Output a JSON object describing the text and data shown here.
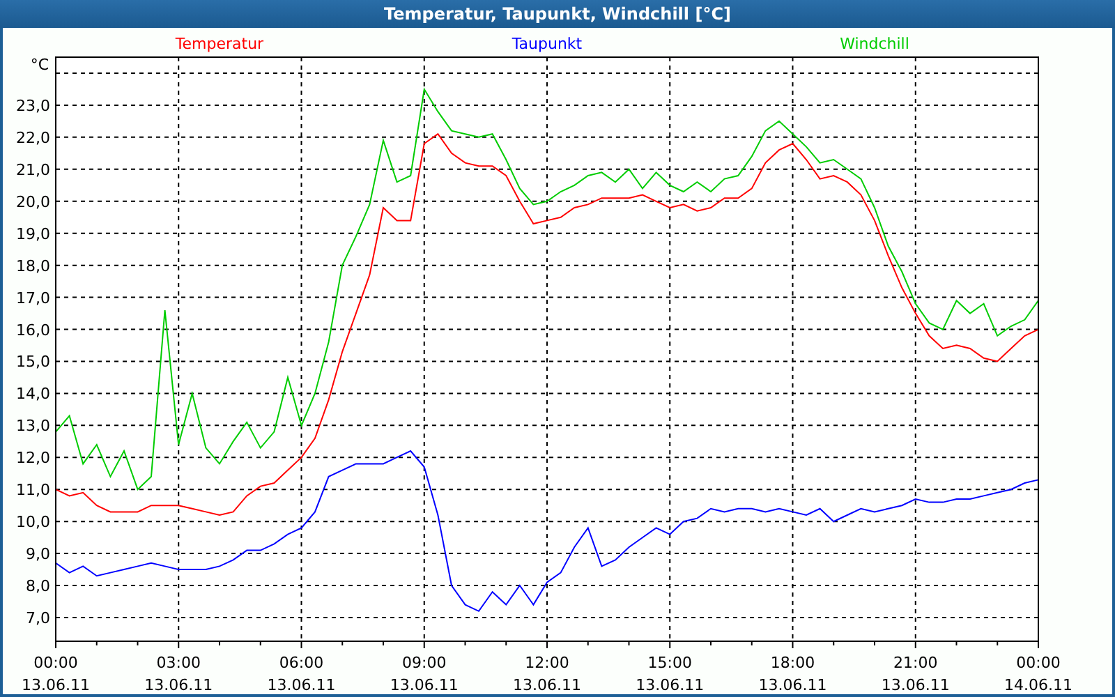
{
  "window": {
    "title": "Temperatur, Taupunkt, Windchill [°C]"
  },
  "chart": {
    "chart_data": {
      "type": "line",
      "grid": true,
      "ylabel": "°C",
      "ylim": [
        6.26,
        24.5
      ],
      "yticks": [
        {
          "value": 7,
          "label": "7,0"
        },
        {
          "value": 8,
          "label": "8,0"
        },
        {
          "value": 9,
          "label": "9,0"
        },
        {
          "value": 10,
          "label": "10,0"
        },
        {
          "value": 11,
          "label": "11,0"
        },
        {
          "value": 12,
          "label": "12,0"
        },
        {
          "value": 13,
          "label": "13,0"
        },
        {
          "value": 14,
          "label": "14,0"
        },
        {
          "value": 15,
          "label": "15,0"
        },
        {
          "value": 16,
          "label": "16,0"
        },
        {
          "value": 17,
          "label": "17,0"
        },
        {
          "value": 18,
          "label": "18,0"
        },
        {
          "value": 19,
          "label": "19,0"
        },
        {
          "value": 20,
          "label": "20,0"
        },
        {
          "value": 21,
          "label": "21,0"
        },
        {
          "value": 22,
          "label": "22,0"
        },
        {
          "value": 23,
          "label": "23,0"
        }
      ],
      "categories": [
        "00:00 13.06.11",
        null,
        null,
        null,
        null,
        null,
        null,
        null,
        null,
        "03:00 13.06.11",
        null,
        null,
        null,
        null,
        null,
        null,
        null,
        null,
        "06:00 13.06.11",
        null,
        null,
        null,
        null,
        null,
        null,
        null,
        null,
        "09:00 13.06.11",
        null,
        null,
        null,
        null,
        null,
        null,
        null,
        null,
        "12:00 13.06.11",
        null,
        null,
        null,
        null,
        null,
        null,
        null,
        null,
        "15:00 13.06.11",
        null,
        null,
        null,
        null,
        null,
        null,
        null,
        null,
        "18:00 13.06.11",
        null,
        null,
        null,
        null,
        null,
        null,
        null,
        null,
        "21:00 13.06.11",
        null,
        null,
        null,
        null,
        null,
        null,
        null,
        null,
        "00:00 14.06.11"
      ],
      "series": [
        {
          "name": "Temperatur",
          "color": "#ff0000",
          "values": [
            11.0,
            10.8,
            10.9,
            10.5,
            10.3,
            10.3,
            10.3,
            10.5,
            10.5,
            10.5,
            10.4,
            10.3,
            10.2,
            10.3,
            10.8,
            11.1,
            11.2,
            11.6,
            12.0,
            12.6,
            13.8,
            15.3,
            16.5,
            17.7,
            19.8,
            19.4,
            19.4,
            21.8,
            22.1,
            21.5,
            21.2,
            21.1,
            21.1,
            20.8,
            20.0,
            19.3,
            19.4,
            19.5,
            19.8,
            19.9,
            20.1,
            20.1,
            20.1,
            20.2,
            20.0,
            19.8,
            19.9,
            19.7,
            19.8,
            20.1,
            20.1,
            20.4,
            21.2,
            21.6,
            21.8,
            21.3,
            20.7,
            20.8,
            20.6,
            20.2,
            19.4,
            18.3,
            17.3,
            16.5,
            15.8,
            15.4,
            15.5,
            15.4,
            15.1,
            15.0,
            15.4,
            15.8,
            16.0
          ]
        },
        {
          "name": "Taupunkt",
          "color": "#0000ff",
          "values": [
            8.7,
            8.4,
            8.6,
            8.3,
            8.4,
            8.5,
            8.6,
            8.7,
            8.6,
            8.5,
            8.5,
            8.5,
            8.6,
            8.8,
            9.1,
            9.1,
            9.3,
            9.6,
            9.8,
            10.3,
            11.4,
            11.6,
            11.8,
            11.8,
            11.8,
            12.0,
            12.2,
            11.7,
            10.2,
            8.0,
            7.4,
            7.2,
            7.8,
            7.4,
            8.0,
            7.4,
            8.1,
            8.4,
            9.2,
            9.8,
            8.6,
            8.8,
            9.2,
            9.5,
            9.8,
            9.6,
            10.0,
            10.1,
            10.4,
            10.3,
            10.4,
            10.4,
            10.3,
            10.4,
            10.3,
            10.2,
            10.4,
            10.0,
            10.2,
            10.4,
            10.3,
            10.4,
            10.5,
            10.7,
            10.6,
            10.6,
            10.7,
            10.7,
            10.8,
            10.9,
            11.0,
            11.2,
            11.3
          ]
        },
        {
          "name": "Windchill",
          "color": "#00cc00",
          "values": [
            12.8,
            13.3,
            11.8,
            12.4,
            11.4,
            12.2,
            11.0,
            11.4,
            16.6,
            12.4,
            14.0,
            12.3,
            11.8,
            12.5,
            13.1,
            12.3,
            12.8,
            14.5,
            13.0,
            14.0,
            15.6,
            18.0,
            18.9,
            19.9,
            21.9,
            20.6,
            20.8,
            23.5,
            22.8,
            22.2,
            22.1,
            22.0,
            22.1,
            21.3,
            20.4,
            19.9,
            20.0,
            20.3,
            20.5,
            20.8,
            20.9,
            20.6,
            21.0,
            20.4,
            20.9,
            20.5,
            20.3,
            20.6,
            20.3,
            20.7,
            20.8,
            21.4,
            22.2,
            22.5,
            22.1,
            21.7,
            21.2,
            21.3,
            21.0,
            20.7,
            19.8,
            18.6,
            17.8,
            16.8,
            16.2,
            16.0,
            16.9,
            16.5,
            16.8,
            15.8,
            16.1,
            16.3,
            16.9
          ]
        }
      ]
    }
  }
}
